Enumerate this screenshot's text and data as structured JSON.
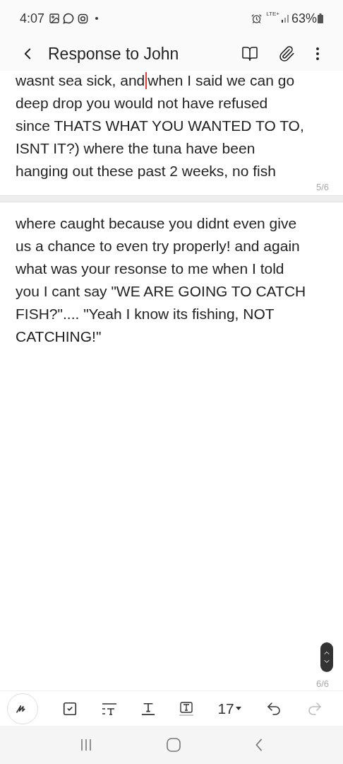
{
  "status_bar": {
    "time": "4:07",
    "network": "LTE+",
    "battery": "63%"
  },
  "header": {
    "title": "Response to John"
  },
  "pages": [
    {
      "lines": [
        {
          "before": "wasnt sea sick, and",
          "cursor": true,
          "after": "when I said we can go"
        },
        {
          "before": "deep drop you would not have refused",
          "cursor": false
        },
        {
          "before": "since THATS WHAT YOU WANTED TO TO,",
          "cursor": false
        },
        {
          "before": "ISNT IT?) where the tuna have been",
          "cursor": false
        },
        {
          "before": "hanging out these past 2 weeks, no fish",
          "cursor": false
        }
      ],
      "page_number": "5/6"
    },
    {
      "lines": [
        {
          "before": "where caught because you didnt even give",
          "cursor": false
        },
        {
          "before": "us a chance to even try properly! and again",
          "cursor": false
        },
        {
          "before": "what was your resonse to me when I told",
          "cursor": false
        },
        {
          "before": "you I cant say \"WE ARE GOING TO CATCH",
          "cursor": false
        },
        {
          "before": "FISH?\".... \"Yeah I know its fishing, NOT",
          "cursor": false
        },
        {
          "before": "CATCHING!\"",
          "cursor": false
        }
      ],
      "page_number": "6/6"
    }
  ],
  "toolbar": {
    "font_size": "17",
    "undo_disabled": false,
    "redo_disabled": true
  }
}
